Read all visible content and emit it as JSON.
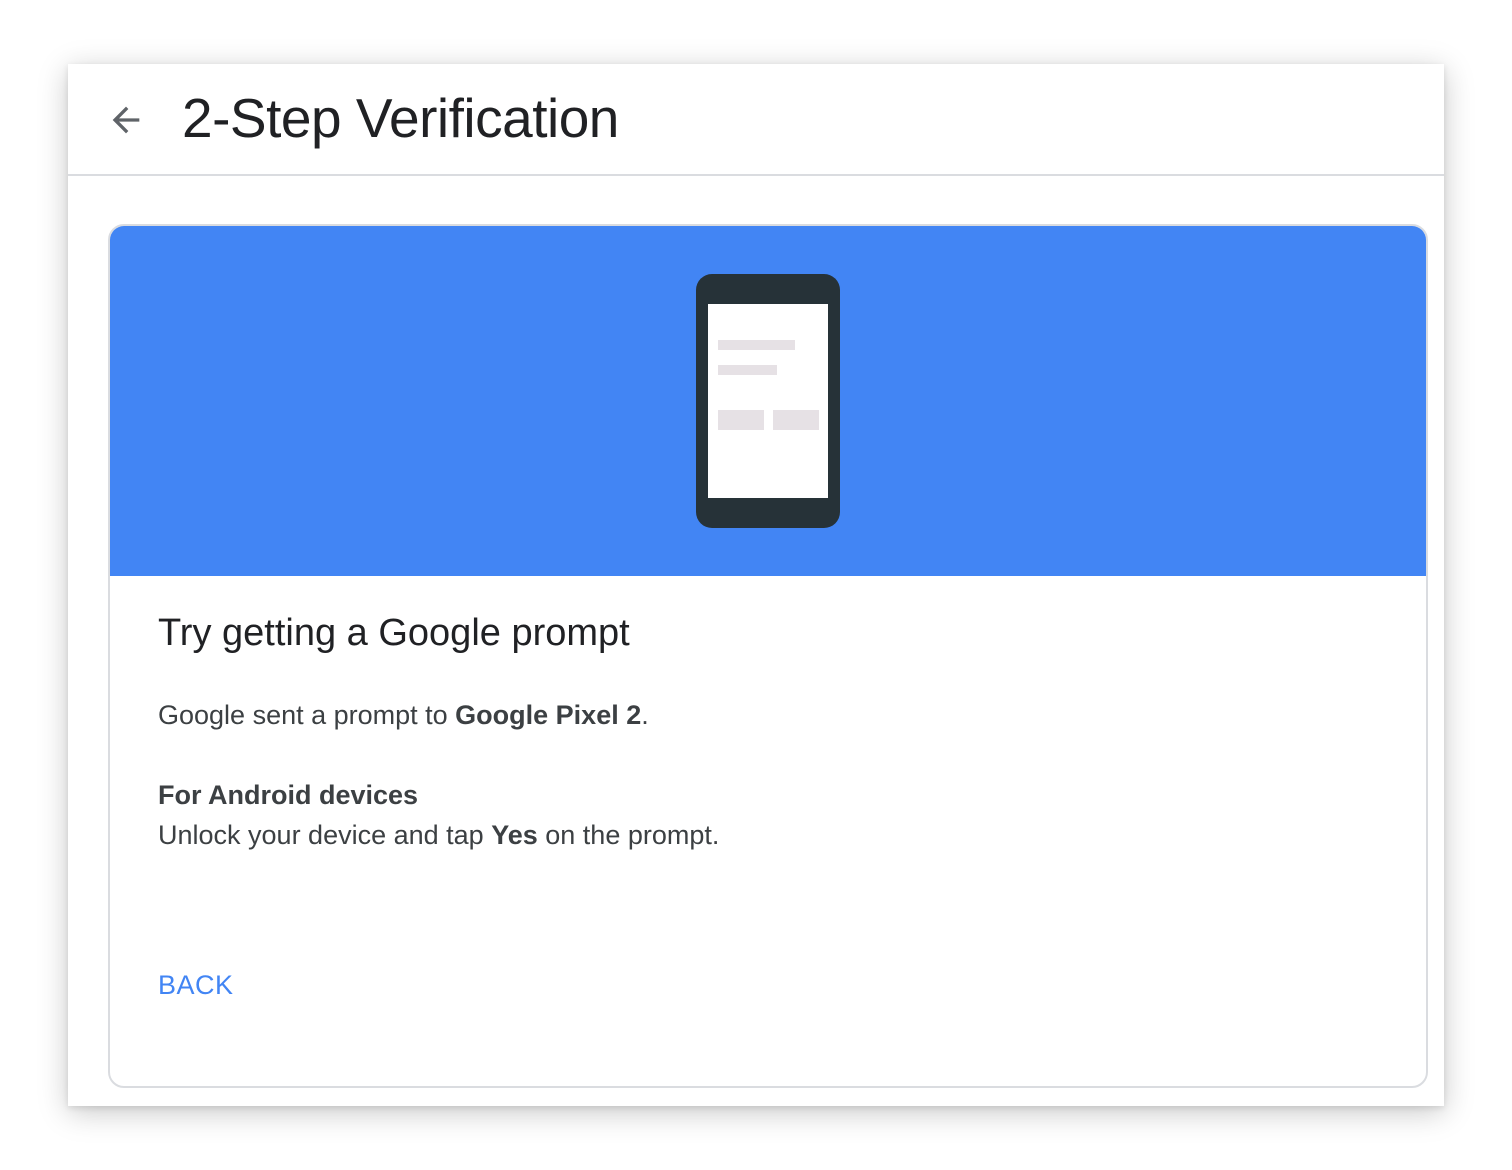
{
  "header": {
    "title": "2-Step Verification",
    "back_icon": "arrow-left-icon"
  },
  "card": {
    "hero_color": "#4285f4",
    "illustration": "phone-icon",
    "title": "Try getting a Google prompt",
    "prompt_prefix": "Google sent a prompt to ",
    "device_name": "Google Pixel 2",
    "prompt_suffix": ".",
    "android_heading": "For Android devices",
    "instruction_prefix": "Unlock your device and tap ",
    "instruction_bold": "Yes",
    "instruction_suffix": " on the prompt.",
    "back_label": "BACK"
  }
}
